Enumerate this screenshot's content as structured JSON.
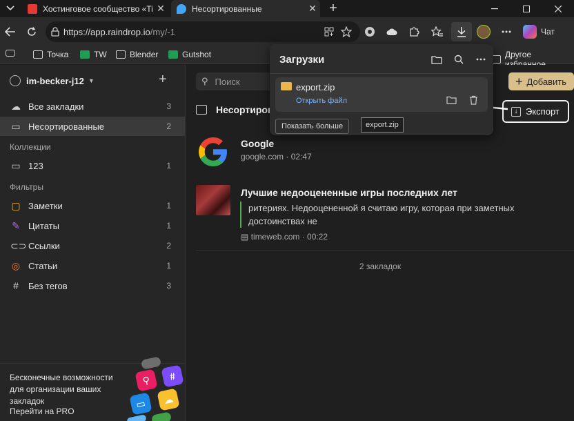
{
  "browser": {
    "tabs": [
      {
        "title": "Хостинговое сообщество «Timew",
        "favicon_color": "#e53935",
        "active": false
      },
      {
        "title": "Несортированные",
        "favicon_color": "#42a5f5",
        "active": true
      }
    ],
    "url_host": "https://app.raindrop.io",
    "url_path": "/my/-1",
    "chat_label": "Чат",
    "bookmarks": [
      "Точка",
      "TW",
      "Blender",
      "Gutshot"
    ],
    "other_bookmarks": "Другое избранное"
  },
  "sidebar": {
    "username": "im-becker-j12",
    "items": [
      {
        "label": "Все закладки",
        "count": "3",
        "icon": "cloud-icon"
      },
      {
        "label": "Несортированные",
        "count": "2",
        "icon": "inbox-icon"
      }
    ],
    "collections_heading": "Коллекции",
    "collections": [
      {
        "label": "123",
        "count": "1",
        "icon": "folder-icon"
      }
    ],
    "filters_heading": "Фильтры",
    "filters": [
      {
        "label": "Заметки",
        "count": "1",
        "icon": "note-icon",
        "color": "#f5b82e"
      },
      {
        "label": "Цитаты",
        "count": "1",
        "icon": "quote-icon",
        "color": "#b06ad8"
      },
      {
        "label": "Ссылки",
        "count": "2",
        "icon": "link-icon",
        "color": "#aaaaaa"
      },
      {
        "label": "Статьи",
        "count": "1",
        "icon": "article-icon",
        "color": "#f07830"
      },
      {
        "label": "Без тегов",
        "count": "3",
        "icon": "hash-icon",
        "color": "#aaaaaa"
      }
    ],
    "promo": {
      "text": "Бесконечные возможности для организации ваших закладок",
      "link": "Перейти на PRO"
    }
  },
  "main": {
    "search_placeholder": "Поиск",
    "partial_label": "ть",
    "add_button": "Добавить",
    "collection_title": "Несортиров",
    "export_button": "Экспорт",
    "bookmarks": [
      {
        "title": "Google",
        "domain": "google.com",
        "time": "02:47"
      },
      {
        "title": "Лучшие недооцененные игры последних лет",
        "excerpt": "ритериях. Недооцененной я считаю игру, которая при заметных достоинствах не",
        "domain": "timeweb.com",
        "time": "00:22"
      }
    ],
    "count_label": "2 закладок"
  },
  "downloads": {
    "title": "Загрузки",
    "file_name": "export.zip",
    "open_file": "Открыть файл",
    "show_more": "Показать больше",
    "tooltip": "export.zip"
  },
  "colors": {
    "accent_add": "#d9c08a",
    "link_blue": "#7cb6ff",
    "excerpt_bar": "#4caf50"
  }
}
